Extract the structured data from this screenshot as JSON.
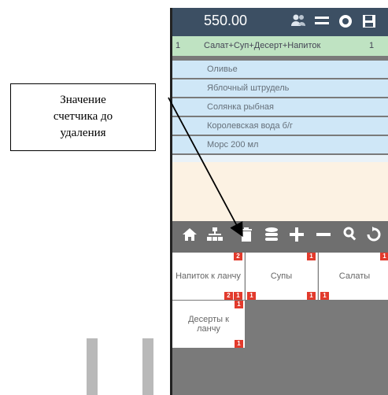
{
  "header": {
    "total": "550.00",
    "icons": [
      "users-icon",
      "menu-icon",
      "settings-icon",
      "save-icon"
    ]
  },
  "order": {
    "row": {
      "num": "1",
      "name": "Салат+Суп+Десерт+Напиток",
      "qty": "1"
    },
    "items": [
      "Оливье",
      "Яблочный штрудель",
      "Солянка рыбная",
      "Королевская вода б/г",
      "Морс 200 мл"
    ]
  },
  "toolbar": {
    "icons": [
      "home-icon",
      "tree-icon",
      "trash-icon",
      "stack-icon",
      "plus-icon",
      "minus-icon",
      "search-icon",
      "refresh-icon"
    ]
  },
  "categories": [
    {
      "label": "Напиток к ланчу",
      "badge_top": "2",
      "badge_bottom_left": "2",
      "badge_bottom_right": "1"
    },
    {
      "label": "Супы",
      "badge_top": "1",
      "badge_bottom_left": "1",
      "badge_bottom_right": "1"
    },
    {
      "label": "Салаты",
      "badge_top": "1",
      "badge_bottom_left": "1",
      "badge_bottom_right": ""
    },
    {
      "label": "Десерты к ланчу",
      "badge_top": "1",
      "badge_bottom_left": "1",
      "badge_bottom_right": ""
    }
  ],
  "callout": {
    "text_line1": "Значение",
    "text_line2": "счетчика до",
    "text_line3": "удаления"
  }
}
